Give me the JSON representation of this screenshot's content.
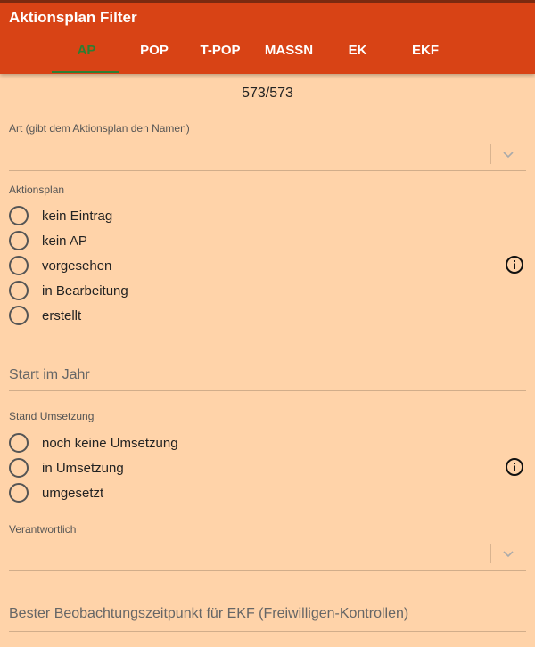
{
  "app": {
    "title": "Aktionsplan Filter"
  },
  "tabs": [
    {
      "label": "AP",
      "active": true
    },
    {
      "label": "POP",
      "active": false
    },
    {
      "label": "T-POP",
      "active": false
    },
    {
      "label": "MASSN",
      "active": false
    },
    {
      "label": "EK",
      "active": false
    },
    {
      "label": "EKF",
      "active": false
    }
  ],
  "count": "573/573",
  "art": {
    "label": "Art (gibt dem Aktionsplan den Namen)",
    "value": ""
  },
  "aktionsplan": {
    "label": "Aktionsplan",
    "options": [
      "kein Eintrag",
      "kein AP",
      "vorgesehen",
      "in Bearbeitung",
      "erstellt"
    ],
    "info_icon": "info-icon"
  },
  "start_jahr": {
    "label": "Start im Jahr",
    "value": ""
  },
  "stand_umsetzung": {
    "label": "Stand Umsetzung",
    "options": [
      "noch keine Umsetzung",
      "in Umsetzung",
      "umgesetzt"
    ],
    "info_icon": "info-icon"
  },
  "verantwortlich": {
    "label": "Verantwortlich",
    "value": ""
  },
  "ekf_zeitpunkt": {
    "label": "Bester Beobachtungszeitpunkt für EKF (Freiwilligen-Kontrollen)",
    "value": ""
  },
  "colors": {
    "appbar": "#d84315",
    "background": "#ffd3a9",
    "active_tab": "#2e7d32"
  }
}
